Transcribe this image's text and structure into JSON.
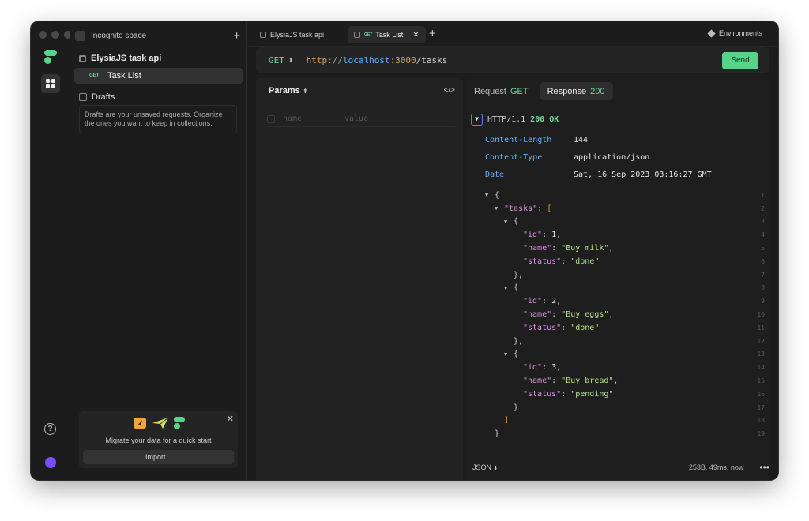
{
  "sidebar": {
    "space_label": "Incognito space",
    "collection_name": "ElysiaJS task api",
    "request_method": "GET",
    "request_name": "Task List",
    "drafts_label": "Drafts",
    "drafts_note": "Drafts are your unsaved requests. Organize the ones you want to keep in collections.",
    "migrate_text": "Migrate your data for a quick start",
    "import_label": "Import..."
  },
  "tabs": [
    {
      "label": "ElysiaJS task api"
    },
    {
      "method": "GET",
      "label": "Task List"
    }
  ],
  "environments_label": "Environments",
  "request": {
    "method": "GET",
    "url": {
      "scheme": "http",
      "sep": "://",
      "host": "localhost",
      "port": ":3000",
      "path": "/tasks"
    },
    "send_label": "Send",
    "params_label": "Params",
    "param_name_placeholder": "name",
    "param_value_placeholder": "value"
  },
  "response": {
    "request_tab": "Request",
    "request_tab_method": "GET",
    "response_tab": "Response",
    "response_tab_code": "200",
    "protocol": "HTTP/1.1",
    "status": "200 OK",
    "headers": [
      {
        "key": "Content-Length",
        "value": "144"
      },
      {
        "key": "Content-Type",
        "value": "application/json"
      },
      {
        "key": "Date",
        "value": "Sat, 16 Sep 2023 03:16:27 GMT"
      }
    ],
    "body_lines": [
      {
        "n": "1",
        "fold": true,
        "indent": 0,
        "parts": [
          [
            "p",
            "{"
          ]
        ]
      },
      {
        "n": "2",
        "fold": true,
        "indent": 1,
        "parts": [
          [
            "k",
            "\"tasks\""
          ],
          [
            "p",
            ": "
          ],
          [
            "br",
            "["
          ]
        ]
      },
      {
        "n": "3",
        "fold": true,
        "indent": 2,
        "parts": [
          [
            "p",
            "{"
          ]
        ]
      },
      {
        "n": "4",
        "fold": false,
        "indent": 3,
        "parts": [
          [
            "k",
            "\"id\""
          ],
          [
            "p",
            ": "
          ],
          [
            "n",
            "1"
          ],
          [
            "p",
            ","
          ]
        ]
      },
      {
        "n": "5",
        "fold": false,
        "indent": 3,
        "parts": [
          [
            "k",
            "\"name\""
          ],
          [
            "p",
            ": "
          ],
          [
            "s",
            "\"Buy milk\""
          ],
          [
            "p",
            ","
          ]
        ]
      },
      {
        "n": "6",
        "fold": false,
        "indent": 3,
        "parts": [
          [
            "k",
            "\"status\""
          ],
          [
            "p",
            ": "
          ],
          [
            "s",
            "\"done\""
          ]
        ]
      },
      {
        "n": "7",
        "fold": false,
        "indent": 2,
        "parts": [
          [
            "p",
            "},"
          ]
        ]
      },
      {
        "n": "8",
        "fold": true,
        "indent": 2,
        "parts": [
          [
            "p",
            "{"
          ]
        ]
      },
      {
        "n": "9",
        "fold": false,
        "indent": 3,
        "parts": [
          [
            "k",
            "\"id\""
          ],
          [
            "p",
            ": "
          ],
          [
            "n",
            "2"
          ],
          [
            "p",
            ","
          ]
        ]
      },
      {
        "n": "10",
        "fold": false,
        "indent": 3,
        "parts": [
          [
            "k",
            "\"name\""
          ],
          [
            "p",
            ": "
          ],
          [
            "s",
            "\"Buy eggs\""
          ],
          [
            "p",
            ","
          ]
        ]
      },
      {
        "n": "11",
        "fold": false,
        "indent": 3,
        "parts": [
          [
            "k",
            "\"status\""
          ],
          [
            "p",
            ": "
          ],
          [
            "s",
            "\"done\""
          ]
        ]
      },
      {
        "n": "12",
        "fold": false,
        "indent": 2,
        "parts": [
          [
            "p",
            "},"
          ]
        ]
      },
      {
        "n": "13",
        "fold": true,
        "indent": 2,
        "parts": [
          [
            "p",
            "{"
          ]
        ]
      },
      {
        "n": "14",
        "fold": false,
        "indent": 3,
        "parts": [
          [
            "k",
            "\"id\""
          ],
          [
            "p",
            ": "
          ],
          [
            "n",
            "3"
          ],
          [
            "p",
            ","
          ]
        ]
      },
      {
        "n": "15",
        "fold": false,
        "indent": 3,
        "parts": [
          [
            "k",
            "\"name\""
          ],
          [
            "p",
            ": "
          ],
          [
            "s",
            "\"Buy bread\""
          ],
          [
            "p",
            ","
          ]
        ]
      },
      {
        "n": "16",
        "fold": false,
        "indent": 3,
        "parts": [
          [
            "k",
            "\"status\""
          ],
          [
            "p",
            ": "
          ],
          [
            "s",
            "\"pending\""
          ]
        ]
      },
      {
        "n": "17",
        "fold": false,
        "indent": 2,
        "parts": [
          [
            "p",
            "}"
          ]
        ]
      },
      {
        "n": "18",
        "fold": false,
        "indent": 1,
        "parts": [
          [
            "br",
            "]"
          ]
        ]
      },
      {
        "n": "19",
        "fold": false,
        "indent": 0,
        "parts": [
          [
            "p",
            "}"
          ]
        ]
      }
    ],
    "format_label": "JSON",
    "meta": "253B, 49ms, now"
  },
  "colors": {
    "accent_green": "#5ad38a",
    "key_purple": "#e08ee6",
    "string_green": "#b5e08a",
    "header_blue": "#6ab0f3"
  }
}
